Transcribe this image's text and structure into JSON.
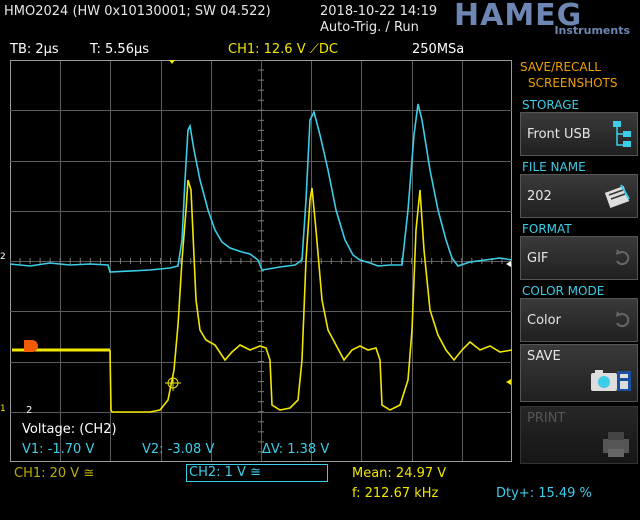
{
  "header": {
    "title": "HMO2024 (HW 0x10130001; SW 04.522)",
    "datetime": "2018-10-22 14:19",
    "trigger_mode": "Auto-Trig. / Run",
    "logo": "HAMEG",
    "logo_sub": "Instruments"
  },
  "info_bar": {
    "timebase": "TB: 2µs",
    "trigger_time": "T: 5.56µs",
    "ch1_trigger": "CH1: 12.6 V ⟋DC",
    "sample_rate": "250MSa"
  },
  "cursor": {
    "label": "Voltage: (CH2)",
    "v1": "V1: -1.70 V",
    "v2": "V2: -3.08 V",
    "dv": "ΔV: 1.38 V"
  },
  "markers": {
    "ch2": "2",
    "ch1": "1"
  },
  "panel": {
    "title_line1": "SAVE/RECALL",
    "title_line2": "SCREENSHOTS",
    "storage_header": "STORAGE",
    "storage_value": "Front USB",
    "file_name_header": "FILE NAME",
    "file_name_value": "202",
    "format_header": "FORMAT",
    "format_value": "GIF",
    "color_mode_header": "COLOR MODE",
    "color_mode_value": "Color",
    "save_label": "SAVE",
    "print_label": "PRINT"
  },
  "status": {
    "ch1_scale": "CH1: 20 V ≅",
    "ch2_scale": "CH2: 1 V ≅",
    "mean": "Mean: 24.97 V",
    "frequency": "f: 212.67 kHz",
    "duty": "Dty+: 15.49 %"
  },
  "colors": {
    "ch1": "#f2e600",
    "ch2": "#3ccde8",
    "menu_header": "#f0a000",
    "logo": "#6d86b3"
  }
}
